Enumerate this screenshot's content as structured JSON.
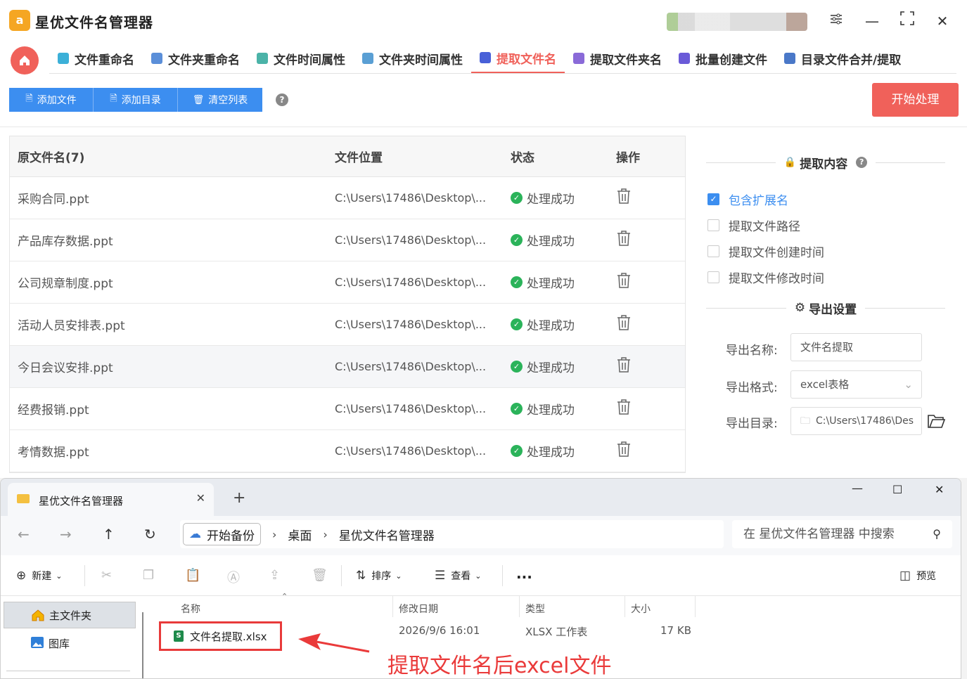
{
  "app": {
    "title": "星优文件名管理器",
    "logo_text": "a",
    "tabs": [
      {
        "label": "文件重命名",
        "icon": "rename-icon",
        "color": "#3cb0d8"
      },
      {
        "label": "文件夹重命名",
        "icon": "folder-rename-icon",
        "color": "#5b8fd9"
      },
      {
        "label": "文件时间属性",
        "icon": "file-time-icon",
        "color": "#4bb3a8"
      },
      {
        "label": "文件夹时间属性",
        "icon": "folder-time-icon",
        "color": "#5a9fd4"
      },
      {
        "label": "提取文件名",
        "icon": "extract-name-icon",
        "color": "#4860d8",
        "active": true
      },
      {
        "label": "提取文件夹名",
        "icon": "extract-folder-icon",
        "color": "#8a6ad8"
      },
      {
        "label": "批量创建文件",
        "icon": "batch-create-icon",
        "color": "#6a5ad8"
      },
      {
        "label": "目录文件合并/提取",
        "icon": "merge-icon",
        "color": "#4a78c8"
      }
    ],
    "toolbar": {
      "add_file": "添加文件",
      "add_dir": "添加目录",
      "clear_list": "清空列表",
      "help": "?",
      "start": "开始处理"
    },
    "table": {
      "headers": [
        "原文件名(7)",
        "文件位置",
        "状态",
        "操作"
      ],
      "rows": [
        {
          "name": "采购合同.ppt",
          "path": "C:\\Users\\17486\\Desktop\\...",
          "status": "处理成功"
        },
        {
          "name": "产品库存数据.ppt",
          "path": "C:\\Users\\17486\\Desktop\\...",
          "status": "处理成功"
        },
        {
          "name": "公司规章制度.ppt",
          "path": "C:\\Users\\17486\\Desktop\\...",
          "status": "处理成功"
        },
        {
          "name": "活动人员安排表.ppt",
          "path": "C:\\Users\\17486\\Desktop\\...",
          "status": "处理成功"
        },
        {
          "name": "今日会议安排.ppt",
          "path": "C:\\Users\\17486\\Desktop\\...",
          "status": "处理成功"
        },
        {
          "name": "经费报销.ppt",
          "path": "C:\\Users\\17486\\Desktop\\...",
          "status": "处理成功"
        },
        {
          "name": "考情数据.ppt",
          "path": "C:\\Users\\17486\\Desktop\\...",
          "status": "处理成功"
        }
      ]
    },
    "panel": {
      "extract_title": "提取内容",
      "options": [
        {
          "label": "包含扩展名",
          "checked": true
        },
        {
          "label": "提取文件路径",
          "checked": false
        },
        {
          "label": "提取文件创建时间",
          "checked": false
        },
        {
          "label": "提取文件修改时间",
          "checked": false
        }
      ],
      "export_title": "导出设置",
      "export_name_label": "导出名称:",
      "export_name_value": "文件名提取",
      "export_format_label": "导出格式:",
      "export_format_value": "excel表格",
      "export_dir_label": "导出目录:",
      "export_dir_value": "C:\\Users\\17486\\Des"
    }
  },
  "explorer": {
    "tab_title": "星优文件名管理器",
    "breadcrumbs": [
      "开始备份",
      "桌面",
      "星优文件名管理器"
    ],
    "search_placeholder": "在 星优文件名管理器 中搜索",
    "commands": {
      "new": "新建",
      "sort": "排序",
      "view": "查看",
      "more": "...",
      "preview": "预览"
    },
    "sidebar": [
      "主文件夹",
      "图库"
    ],
    "columns": [
      "名称",
      "修改日期",
      "类型",
      "大小"
    ],
    "file": {
      "name": "文件名提取.xlsx",
      "modified": "2026/9/6 16:01",
      "type": "XLSX 工作表",
      "size": "17 KB"
    }
  },
  "annotation": "提取文件名后excel文件"
}
